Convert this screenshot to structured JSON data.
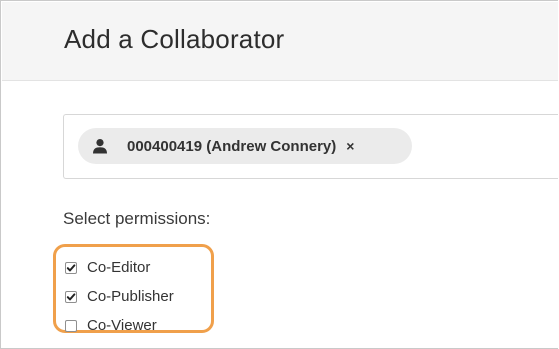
{
  "dialog": {
    "title": "Add a Collaborator"
  },
  "collaborator_field": {
    "chips": [
      {
        "icon": "person-icon",
        "label": "000400419 (Andrew Connery)",
        "remove_label": "×"
      }
    ]
  },
  "permissions": {
    "label": "Select permissions:",
    "highlight_color": "#f0a04b",
    "options": [
      {
        "label": "Co-Editor",
        "checked": true
      },
      {
        "label": "Co-Publisher",
        "checked": true
      },
      {
        "label": "Co-Viewer",
        "checked": false
      }
    ]
  }
}
